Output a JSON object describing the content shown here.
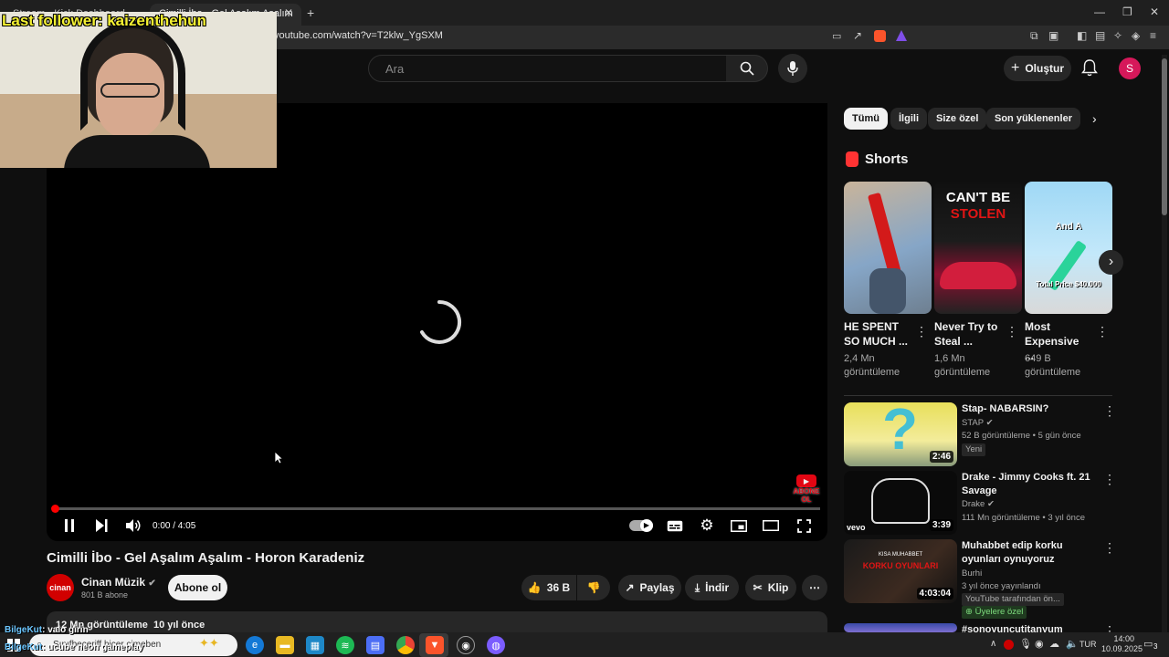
{
  "browser": {
    "tab1": "Stream - Kick Dashboard",
    "tab2": "Cimilli İbo - Gel Aşalım Aşalım",
    "url": "youtube.com/watch?v=T2klw_YgSXM",
    "new_tab_icon": "plus-icon",
    "win_min": "—",
    "win_max": "❐",
    "win_close": "✕"
  },
  "header": {
    "search_placeholder": "Ara",
    "create_label": "Oluştur",
    "avatar_letter": "S"
  },
  "player": {
    "time": "0:00 / 4:05",
    "subscribe_badge_1": "ABONE",
    "subscribe_badge_2": "OL",
    "progress_fraction": 0.0
  },
  "video": {
    "title": "Cimilli İbo - Gel Aşalım Aşalım - Horon Karadeniz",
    "channel": "Cinan Müzik",
    "channel_logo": "cinan",
    "subscribers": "801 B abone",
    "subscribe": "Abone ol",
    "likes": "36 B",
    "share": "Paylaş",
    "download": "İndir",
    "clip": "Klip",
    "views": "12 Mn görüntüleme",
    "ago": "10 yıl önce"
  },
  "chips": [
    "Tümü",
    "İlgili",
    "Size özel",
    "Son yüklenenler"
  ],
  "shorts": {
    "heading": "Shorts",
    "items": [
      {
        "title": "HE SPENT SO MUCH ...",
        "views": "2,4 Mn",
        "suffix": "görüntüleme"
      },
      {
        "title": "Never Try to Steal ...",
        "views": "1,6 Mn",
        "suffix": "görüntüleme",
        "thumb_text_1": "CAN'T BE",
        "thumb_text_2": "STOLEN"
      },
      {
        "title": "Most Expensive ...",
        "views": "649 B",
        "suffix": "görüntüleme",
        "thumb_text_1": "And A",
        "thumb_text_2": "Total Price $40.000"
      }
    ]
  },
  "related": [
    {
      "title": "Stap- NABARSIN?",
      "channel": "STAP",
      "meta": "52 B görüntüleme • 5 gün önce",
      "badge": "Yeni",
      "duration": "2:46"
    },
    {
      "title": "Drake - Jimmy Cooks ft. 21 Savage",
      "channel": "Drake",
      "meta": "111 Mn görüntüleme • 3 yıl önce",
      "duration": "3:39",
      "brand": "vevo"
    },
    {
      "title": "Muhabbet edip korku oyunları oynuyoruz",
      "channel": "Burhi",
      "meta": "3 yıl önce yayınlandı",
      "extra": "YouTube tarafından ön...",
      "badge": "Üyelere özel",
      "duration": "4:03:04",
      "thumb_text_1": "KISA MUHABBET",
      "thumb_text_2": "KORKU OYUNLARI"
    },
    {
      "title": "#sonoyuncutitanyum",
      "channel": "",
      "meta": "",
      "duration": ""
    }
  ],
  "stream": {
    "overlay": "Last follower: kaizenthehun",
    "chat_1_user": "BilgeKut",
    "chat_1_msg": ": valo girin",
    "chat_2_user": "BilgeKut",
    "chat_2_msg": ": ucube neon gameplay"
  },
  "taskbar": {
    "search_text": "Sınıfbeceriff hiçer cimeben",
    "lang": "TUR",
    "time": "14:00",
    "date": "10.09.2025",
    "notif": "3"
  }
}
